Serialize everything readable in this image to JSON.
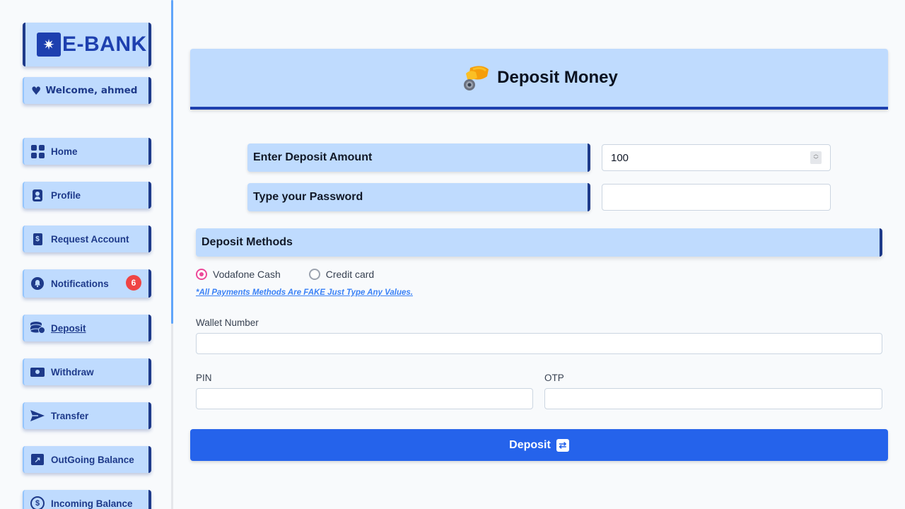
{
  "brand": {
    "name": "E-BANK",
    "logo_icon": "star-burst-icon"
  },
  "welcome": {
    "text": "Welcome, ahmed",
    "icon": "heart-icon"
  },
  "sidebar": {
    "items": [
      {
        "label": "Home",
        "icon": "grid-icon"
      },
      {
        "label": "Profile",
        "icon": "id-badge-icon"
      },
      {
        "label": "Request Account",
        "icon": "dollar-file-icon"
      },
      {
        "label": "Notifications",
        "icon": "bell-icon",
        "badge": "6"
      },
      {
        "label": "Deposit",
        "icon": "coins-stack-icon",
        "active": true
      },
      {
        "label": "Withdraw",
        "icon": "money-bill-icon"
      },
      {
        "label": "Transfer",
        "icon": "send-icon"
      },
      {
        "label": "OutGoing Balance",
        "icon": "chart-line-icon"
      },
      {
        "label": "Incoming Balance",
        "icon": "dollar-coin-icon"
      }
    ]
  },
  "header": {
    "title": "Deposit Money",
    "icon": "hand-holding-coin-icon"
  },
  "form": {
    "amount_label": "Enter Deposit Amount",
    "amount_value": "100",
    "password_label": "Type your Password",
    "password_value": ""
  },
  "methods": {
    "title": "Deposit Methods",
    "options": [
      {
        "label": "Vodafone Cash",
        "selected": true
      },
      {
        "label": "Credit card",
        "selected": false
      }
    ],
    "note": "*All Payments Methods Are FAKE Just Type Any Values."
  },
  "wallet": {
    "wallet_label": "Wallet Number",
    "wallet_value": "",
    "pin_label": "PIN",
    "pin_value": "",
    "otp_label": "OTP",
    "otp_value": ""
  },
  "submit": {
    "label": "Deposit",
    "icon": "exchange-icon"
  },
  "colors": {
    "card_bg": "#bfdbfe",
    "accent_dark": "#1e3a8a",
    "button_blue": "#2563eb",
    "badge_red": "#ef4444",
    "radio_pink": "#ec4899"
  }
}
